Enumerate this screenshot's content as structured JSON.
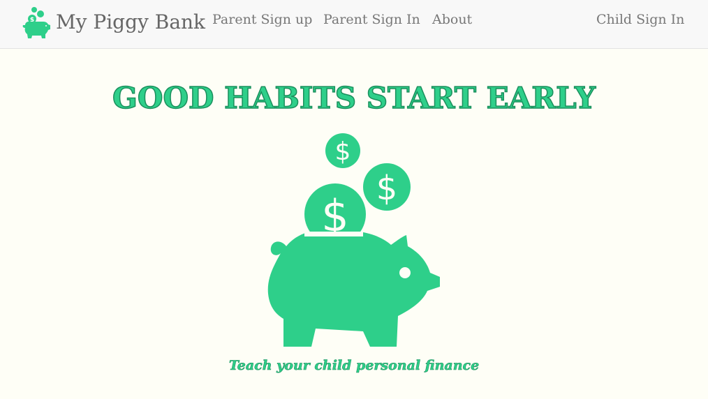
{
  "navbar": {
    "brand": "My Piggy Bank",
    "links": [
      "Parent Sign up",
      "Parent Sign In",
      "About"
    ],
    "right_link": "Child Sign In"
  },
  "hero": {
    "headline": "GOOD HABITS START EARLY",
    "tagline": "Teach your child personal finance",
    "coin_symbol": "$"
  },
  "colors": {
    "accent": "#2ecf8a",
    "accent_outline": "#1a8f5c",
    "page_background": "#fefef6",
    "navbar_background": "#f8f8f8",
    "nav_text": "#777777"
  }
}
